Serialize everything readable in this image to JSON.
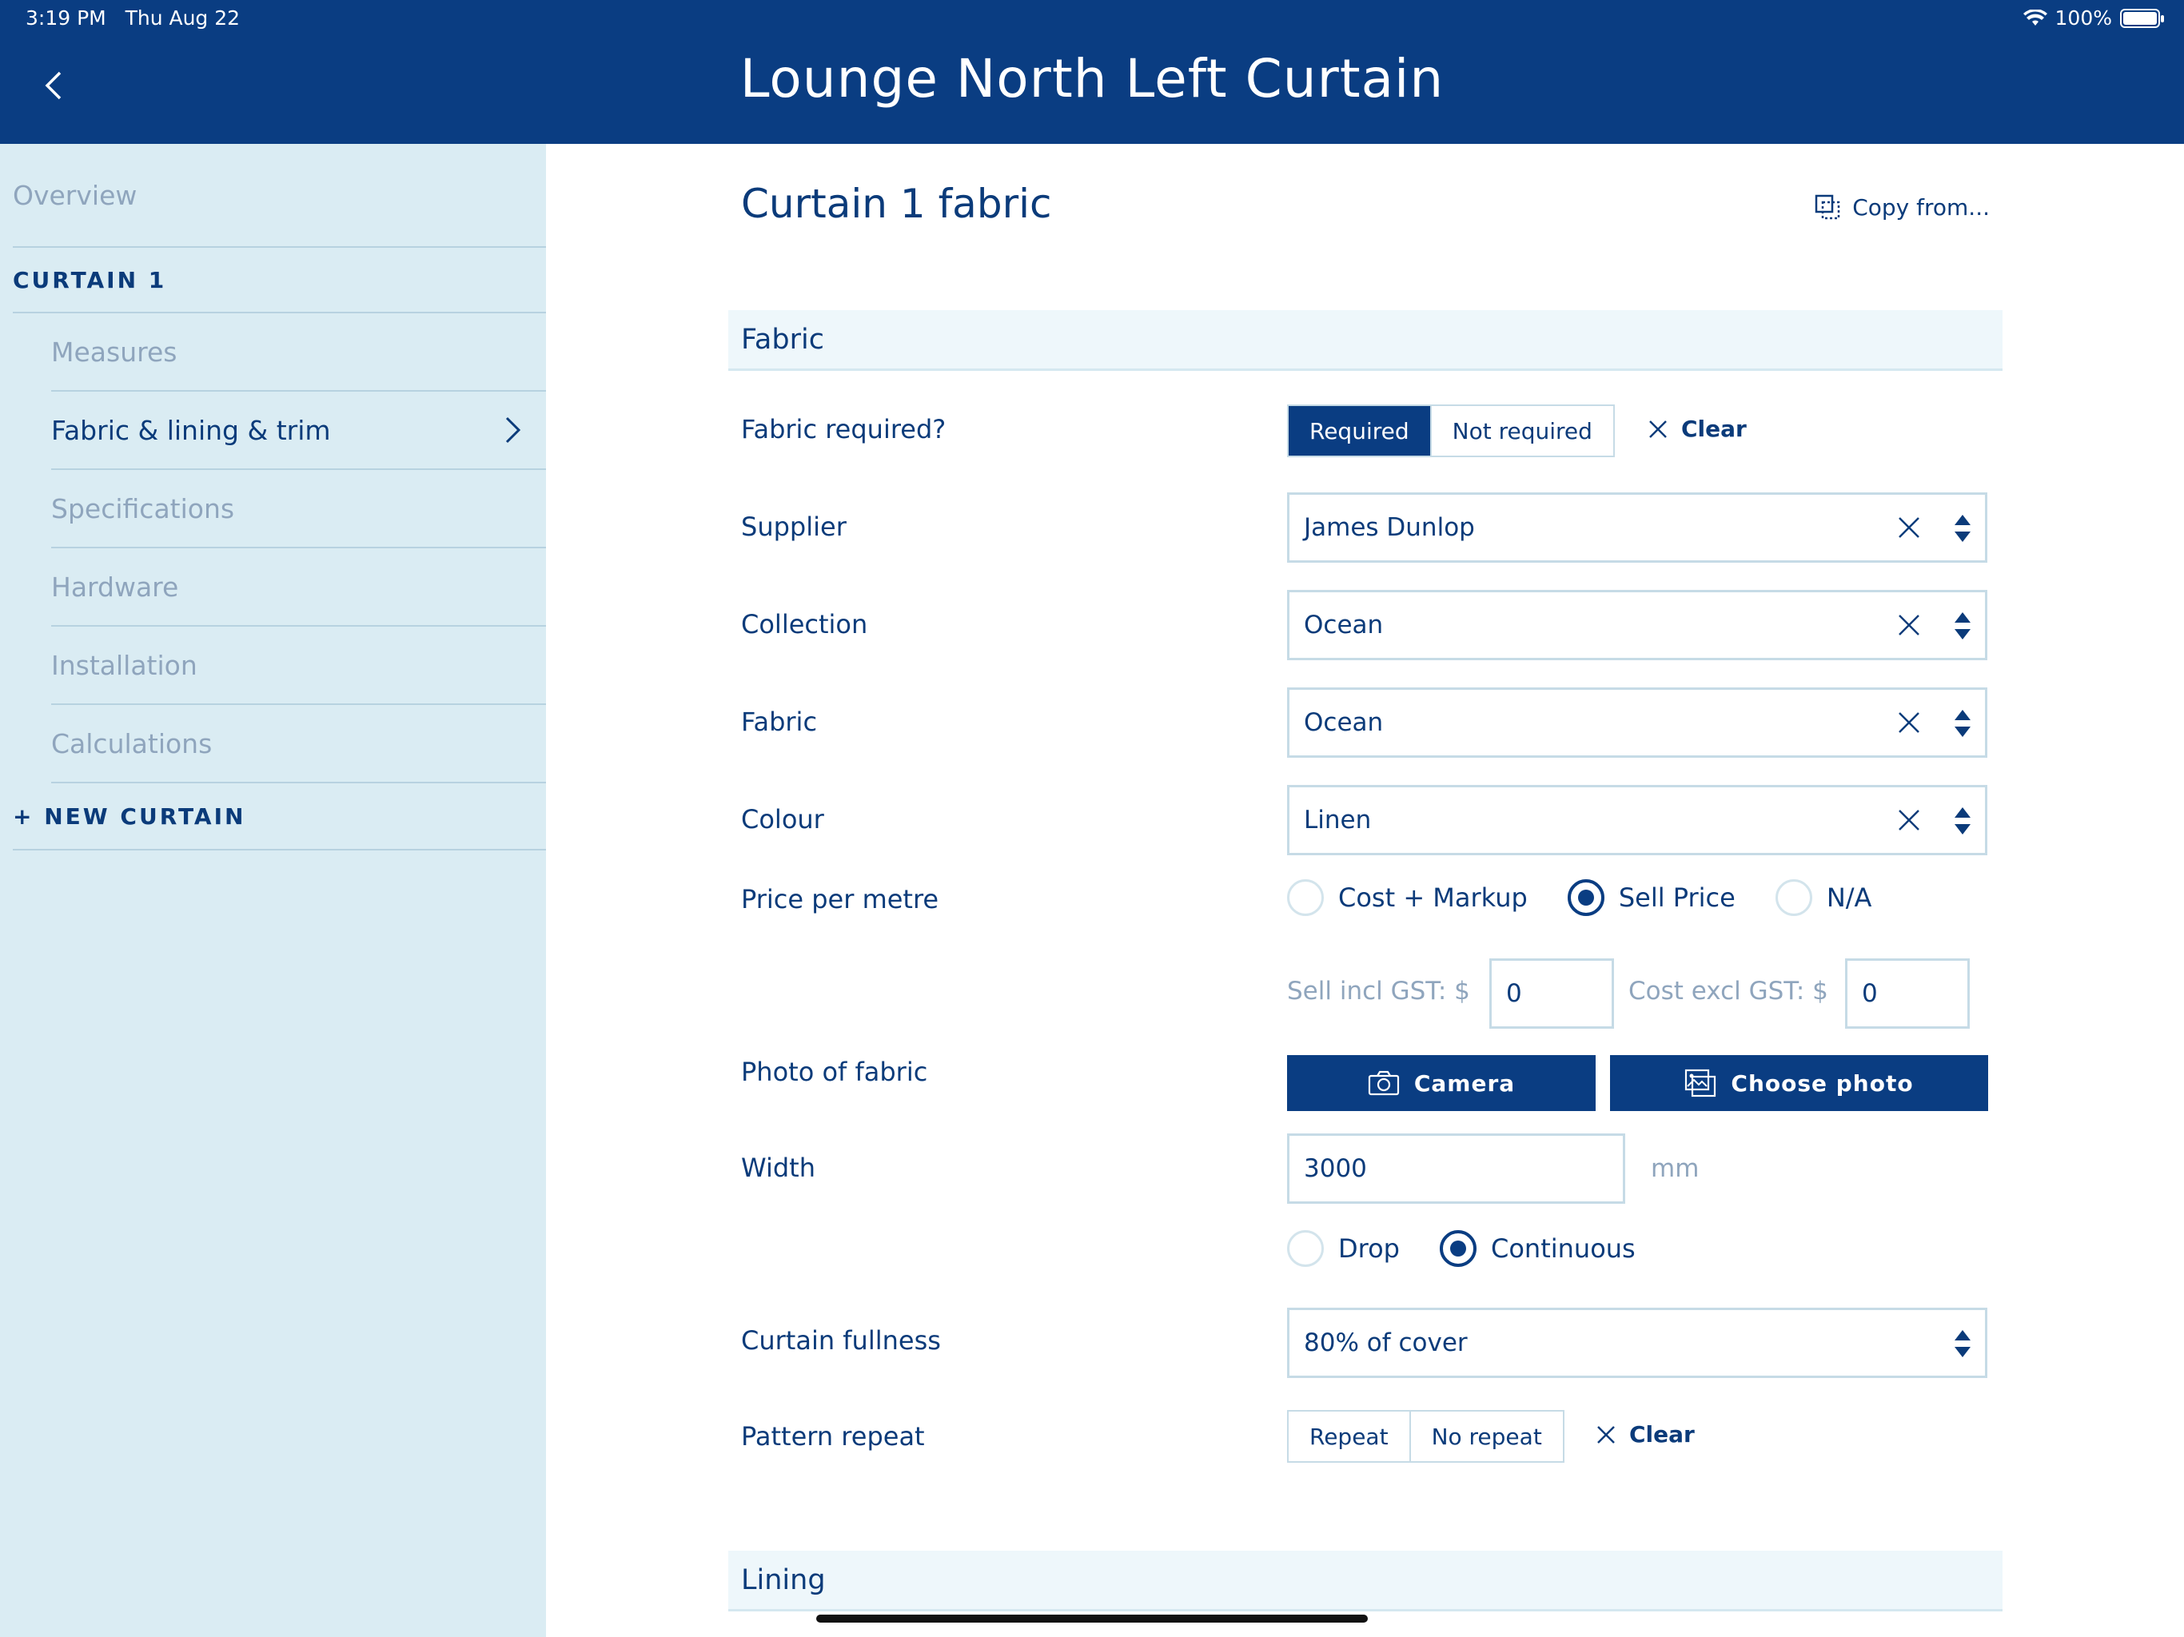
{
  "status_bar": {
    "time": "3:19 PM",
    "date": "Thu Aug 22",
    "battery": "100%"
  },
  "header": {
    "title": "Lounge North Left Curtain"
  },
  "sidebar": {
    "overview": "Overview",
    "curtain": "CURTAIN 1",
    "items": [
      {
        "label": "Measures",
        "active": false
      },
      {
        "label": "Fabric & lining & trim",
        "active": true
      },
      {
        "label": "Specifications",
        "active": false
      },
      {
        "label": "Hardware",
        "active": false
      },
      {
        "label": "Installation",
        "active": false
      },
      {
        "label": "Calculations",
        "active": false
      }
    ],
    "new_curtain": "+ NEW CURTAIN"
  },
  "main": {
    "title": "Curtain 1 fabric",
    "copy_from": "Copy from...",
    "fabric_section": "Fabric",
    "lining_section": "Lining",
    "fabric_required": {
      "label": "Fabric required?",
      "options": [
        "Required",
        "Not required"
      ],
      "selected": "Required",
      "clear": "Clear"
    },
    "supplier": {
      "label": "Supplier",
      "value": "James Dunlop"
    },
    "collection": {
      "label": "Collection",
      "value": "Ocean"
    },
    "fabric": {
      "label": "Fabric",
      "value": "Ocean"
    },
    "colour": {
      "label": "Colour",
      "value": "Linen"
    },
    "price_per_metre": {
      "label": "Price per metre",
      "options": [
        "Cost + Markup",
        "Sell Price",
        "N/A"
      ],
      "selected": "Sell Price",
      "sell_label": "Sell incl GST: $",
      "sell_value": "0",
      "cost_label": "Cost excl GST: $",
      "cost_value": "0"
    },
    "photo": {
      "label": "Photo of fabric",
      "camera": "Camera",
      "choose": "Choose photo"
    },
    "width": {
      "label": "Width",
      "value": "3000",
      "unit": "mm",
      "options": [
        "Drop",
        "Continuous"
      ],
      "selected": "Continuous"
    },
    "fullness": {
      "label": "Curtain fullness",
      "value": "80% of cover"
    },
    "pattern_repeat": {
      "label": "Pattern repeat",
      "options": [
        "Repeat",
        "No repeat"
      ],
      "clear": "Clear"
    }
  },
  "colors": {
    "brand": "#0a3d82",
    "sidebar_bg": "#daecf3",
    "muted": "#8fa5bd"
  }
}
